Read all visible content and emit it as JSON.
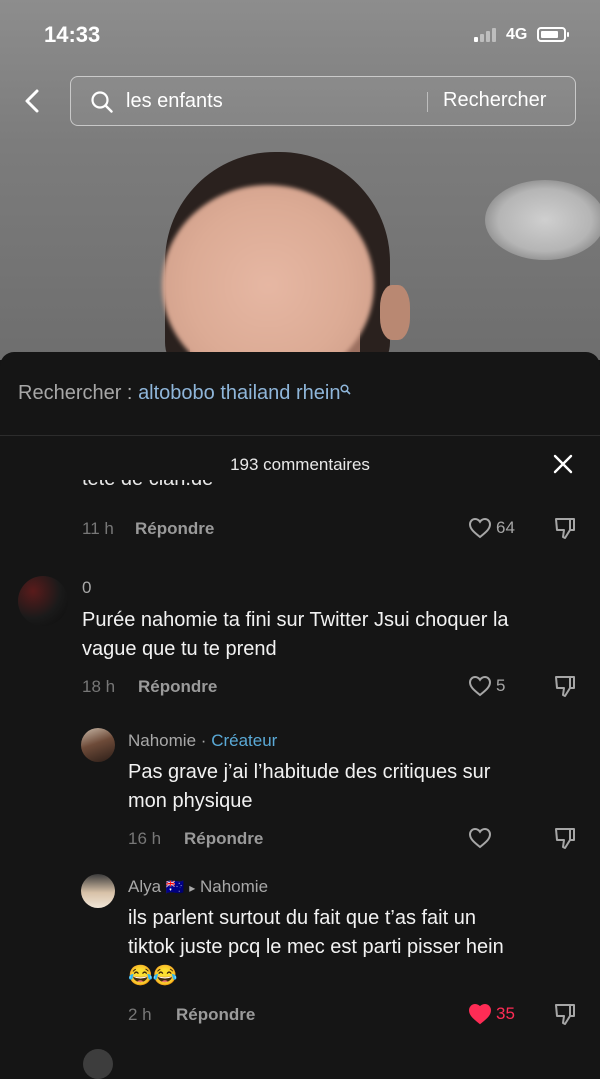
{
  "status_bar": {
    "time": "14:33",
    "network": "4G"
  },
  "search": {
    "query": "les enfants",
    "button": "Rechercher"
  },
  "suggestion": {
    "label": "Rechercher :",
    "query": "altobobo thailand rhein"
  },
  "comments_header": {
    "count_label": "193 commentaires"
  },
  "cut_comment": {
    "text": "tête de clan.de",
    "time": "11 h",
    "reply": "Répondre",
    "likes": "64"
  },
  "comments": [
    {
      "name": "0",
      "text_line1": "Purée nahomie ta fini sur Twitter Jsui choquer la",
      "text_line2": "vague que tu te prend",
      "time": "18 h",
      "reply": "Répondre",
      "likes": "5"
    },
    {
      "name": "Nahomie",
      "badge_sep": "·",
      "badge": "Créateur",
      "text_line1": "Pas grave j’ai l’habitude des critiques sur",
      "text_line2": "mon physique",
      "time": "16 h",
      "reply": "Répondre"
    },
    {
      "name": "Alya",
      "flag": "🇦🇺",
      "arrow": "▸",
      "reply_to": "Nahomie",
      "text_line1": "ils parlent surtout du fait que t’as fait un",
      "text_line2": "tiktok juste pcq le mec est parti pisser hein",
      "text_line3": "😂😂",
      "time": "2 h",
      "reply": "Répondre",
      "likes": "35",
      "liked_color": "#fe2c55"
    }
  ]
}
